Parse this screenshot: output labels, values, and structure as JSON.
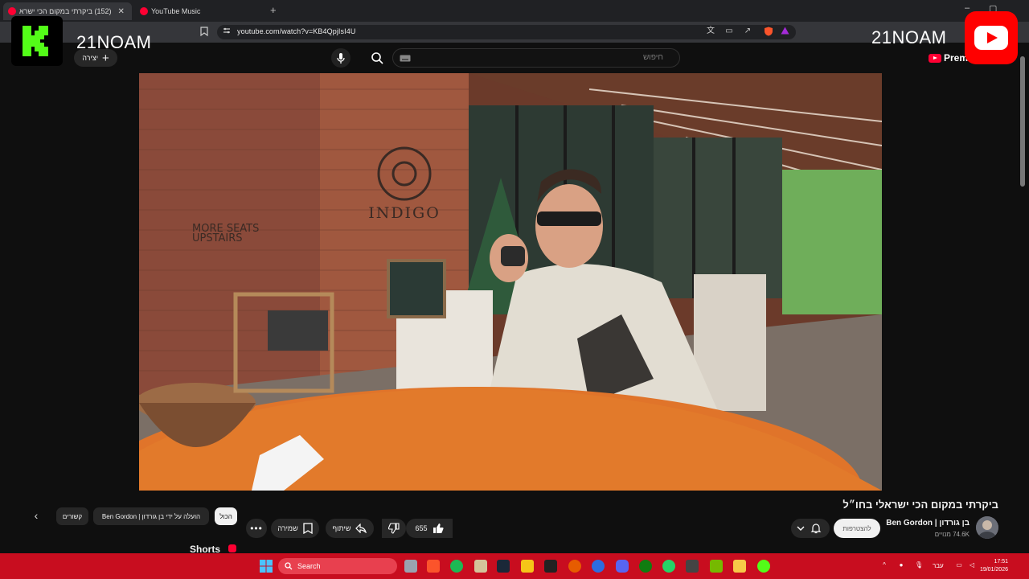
{
  "browser": {
    "tabs": [
      {
        "title": "(152) ביקרתי במקום הכי ישרא",
        "active": true
      },
      {
        "title": "YouTube Music",
        "active": false
      }
    ],
    "new_tab_symbol": "+",
    "close_symbol": "✕",
    "url": "youtube.com/watch?v=KB4QpjIsI4U"
  },
  "masthead": {
    "search_placeholder": "חיפוש",
    "create_label": "יצירה",
    "premium_label": "Premi"
  },
  "overlay": {
    "left_handle": "21NOAM",
    "right_handle": "21NOAM"
  },
  "video": {
    "title": "ביקרתי במקום הכי ישראלי בחו״ל",
    "scene_sign_brand": "INDIGO",
    "scene_sign_wall": "MORE SEATS\nUPSTAIRS"
  },
  "channel": {
    "name": "בן גורדון | Ben Gordon",
    "subscribers": "74.6K מנויים",
    "subscribe_label": "להצטרפות"
  },
  "actions": {
    "like_count": "655",
    "share_label": "שיתוף",
    "save_label": "שמירה"
  },
  "chips": [
    {
      "label": "הכול",
      "active": true
    },
    {
      "label": "הועלה על ידי בן גורדון | Ben Gordon",
      "active": false
    },
    {
      "label": "קשורים",
      "active": false
    }
  ],
  "shorts_label": "Shorts",
  "taskbar": {
    "search_label": "Search",
    "language": "עבר",
    "time": "17:51",
    "date": "19/01/2026"
  },
  "colors": {
    "youtube_red": "#ff0033",
    "taskbar_red": "#c80d1f",
    "k_green": "#53fc18"
  }
}
